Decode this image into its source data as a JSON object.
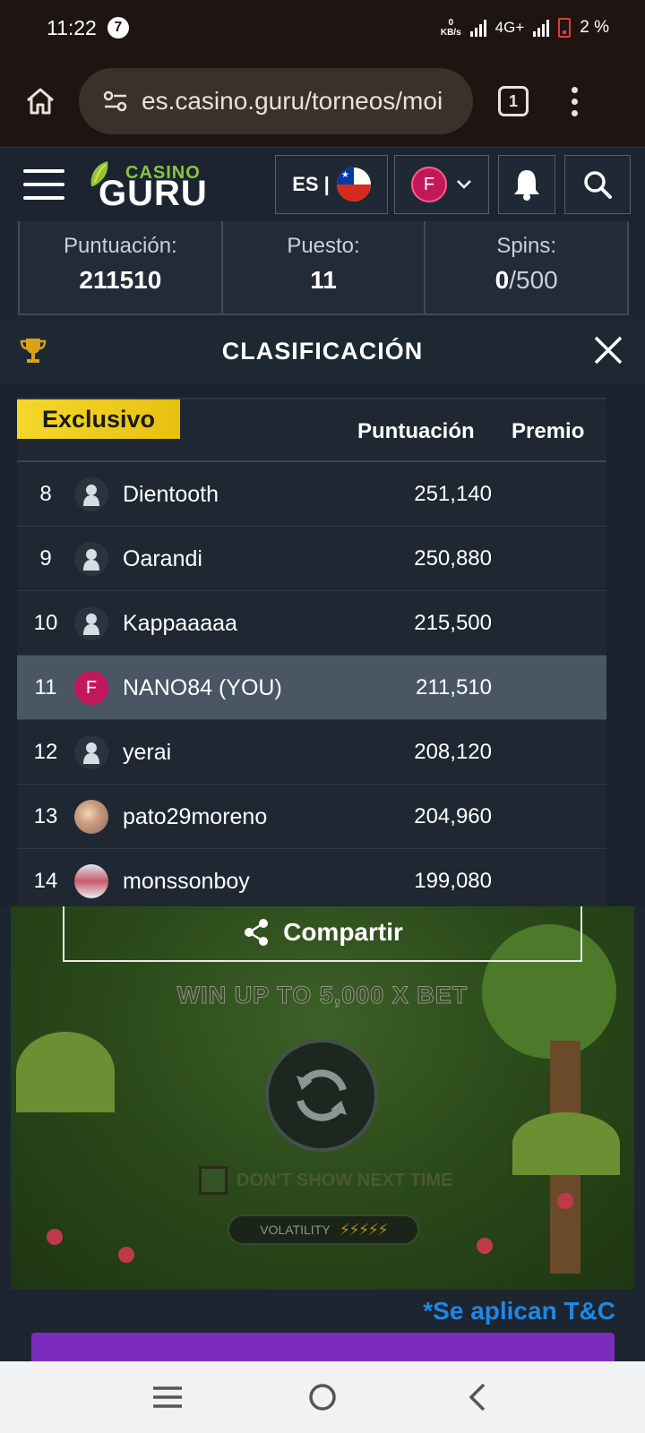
{
  "status_bar": {
    "time": "11:22",
    "notification_count": "7",
    "data_rate_value": "0",
    "data_rate_unit": "KB/s",
    "network": "4G+",
    "battery": "2 %"
  },
  "browser": {
    "url": "es.casino.guru/torneos/moi",
    "tab_count": "1"
  },
  "site_header": {
    "logo_top": "CASINO",
    "logo_bottom": "GURU",
    "language": "ES |",
    "user_initial": "F"
  },
  "stats": [
    {
      "label": "Puntuación:",
      "value": "211510"
    },
    {
      "label": "Puesto:",
      "value": "11"
    },
    {
      "label": "Spins:",
      "value_bold": "0",
      "value_rest": "/500"
    }
  ],
  "leaderboard": {
    "title": "CLASIFICACIÓN",
    "badge": "Exclusivo",
    "col_score": "Puntuación",
    "col_prize": "Premio",
    "rows": [
      {
        "rank": "8",
        "name": "Dientooth",
        "score": "251,140",
        "avatar": "default"
      },
      {
        "rank": "9",
        "name": "Oarandi",
        "score": "250,880",
        "avatar": "default"
      },
      {
        "rank": "10",
        "name": "Kappaaaaa",
        "score": "215,500",
        "avatar": "default"
      },
      {
        "rank": "11",
        "name": "NANO84 (YOU)",
        "score": "211,510",
        "avatar": "initial",
        "initial": "F"
      },
      {
        "rank": "12",
        "name": "yerai",
        "score": "208,120",
        "avatar": "default"
      },
      {
        "rank": "13",
        "name": "pato29moreno",
        "score": "204,960",
        "avatar": "photo"
      },
      {
        "rank": "14",
        "name": "monssonboy",
        "score": "199,080",
        "avatar": "photo"
      }
    ]
  },
  "game": {
    "share_label": "Compartir",
    "headline": "WIN UP TO 5,000 X BET",
    "dont_show": "DON'T SHOW NEXT TIME",
    "volatility": "VOLATILITY"
  },
  "tc_link": "*Se aplican T&C",
  "colors": {
    "accent_yellow": "#f4d72b",
    "user_pink": "#c2185b",
    "link_blue": "#1e88e5",
    "cta_purple": "#7b2cbf"
  }
}
